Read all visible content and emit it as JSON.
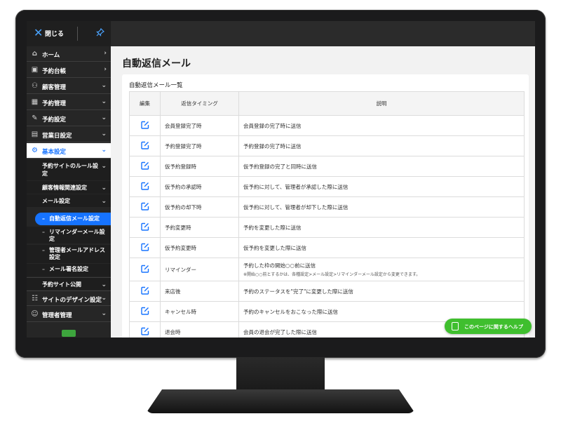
{
  "topbar": {
    "close_label": "閉じる"
  },
  "sidebar": {
    "items": [
      {
        "label": "ホーム",
        "icon": "home-icon",
        "arrow": "›"
      },
      {
        "label": "予約台帳",
        "icon": "ledger-icon",
        "arrow": "›"
      },
      {
        "label": "顧客管理",
        "icon": "customers-icon",
        "arrow": "⌄"
      },
      {
        "label": "予約管理",
        "icon": "calendar-icon",
        "arrow": "⌄"
      },
      {
        "label": "予約設定",
        "icon": "edit-icon",
        "arrow": "⌄"
      },
      {
        "label": "営業日設定",
        "icon": "calendar-grid-icon",
        "arrow": "⌄"
      },
      {
        "label": "基本設定",
        "icon": "gear-icon",
        "arrow": "⌄"
      }
    ],
    "sub_items": [
      {
        "label": "予約サイトのルール設定",
        "arrow": "⌄"
      },
      {
        "label": "顧客情報関連設定",
        "arrow": "⌄"
      },
      {
        "label": "メール設定",
        "arrow": "⌄"
      }
    ],
    "mail_items": [
      {
        "label": "自動返信メール設定"
      },
      {
        "label": "リマインダーメール設定"
      },
      {
        "label": "管理者メールアドレス設定"
      },
      {
        "label": "メール署名設定"
      }
    ],
    "after_items": [
      {
        "label": "予約サイト公開",
        "arrow": "⌄"
      }
    ],
    "bottom_items": [
      {
        "label": "サイトのデザイン設定",
        "icon": "sitemap-icon",
        "arrow": "⌄"
      },
      {
        "label": "管理者管理",
        "icon": "user-icon",
        "arrow": "⌄"
      }
    ]
  },
  "main": {
    "title": "自動返信メール",
    "card_title": "自動返信メール一覧",
    "columns": [
      "編集",
      "返信タイミング",
      "説明"
    ],
    "rows": [
      {
        "timing": "会員登録完了時",
        "desc": "会員登録の完了時に送信",
        "note": ""
      },
      {
        "timing": "予約登録完了時",
        "desc": "予約登録の完了時に送信",
        "note": ""
      },
      {
        "timing": "仮予約登録時",
        "desc": "仮予約登録の完了と同時に送信",
        "note": ""
      },
      {
        "timing": "仮予約の承認時",
        "desc": "仮予約に対して、管理者が承認した際に送信",
        "note": ""
      },
      {
        "timing": "仮予約の却下時",
        "desc": "仮予約に対して、管理者が却下した際に送信",
        "note": ""
      },
      {
        "timing": "予約変更時",
        "desc": "予約を変更した際に送信",
        "note": ""
      },
      {
        "timing": "仮予約変更時",
        "desc": "仮予約を変更した際に送信",
        "note": ""
      },
      {
        "timing": "リマインダー",
        "desc": "予約した枠の開始○○前に送信",
        "note": "※開始○○前とするかは、各種設定>メール設定>リマインダーメール設定から変更できます。"
      },
      {
        "timing": "来店後",
        "desc": "予約のステータスを\"完了\"に変更した際に送信",
        "note": ""
      },
      {
        "timing": "キャンセル時",
        "desc": "予約のキャンセルをおこなった際に送信",
        "note": ""
      },
      {
        "timing": "退会時",
        "desc": "会員の退会が完了した際に送信",
        "note": ""
      }
    ]
  },
  "help": {
    "label": "このページに関するヘルプ"
  },
  "colors": {
    "accent": "#1673ff",
    "help_green": "#3fbf2e",
    "sidebar_bg": "#262626"
  }
}
